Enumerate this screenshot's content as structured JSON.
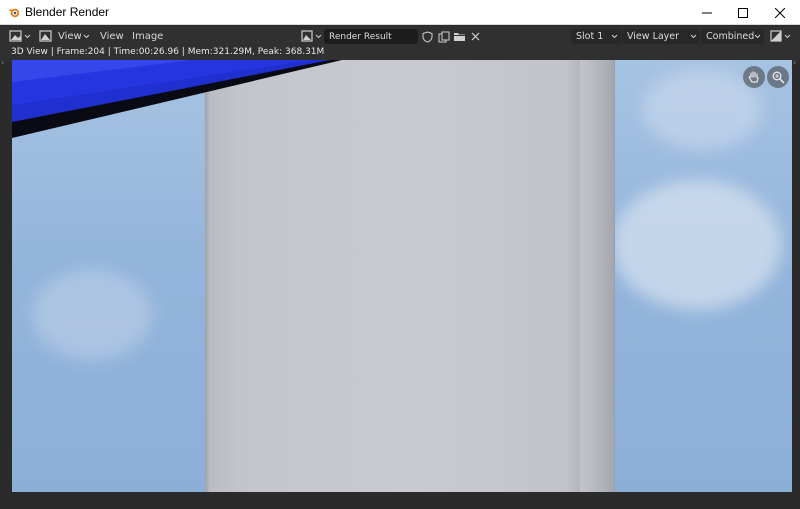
{
  "window": {
    "title": "Blender Render",
    "controls": [
      "minimize",
      "maximize",
      "close"
    ]
  },
  "header": {
    "editor_type_icon": "image-editor-icon",
    "view_mode_icon": "image-view-icon",
    "menus": [
      "View",
      "View",
      "Image"
    ],
    "image_browse_icon": "image-browse-icon",
    "image_name": "Render Result",
    "field_icons": [
      "fake-user-shield-icon",
      "duplicate-icon",
      "open-folder-icon",
      "close-icon"
    ],
    "slot": "Slot 1",
    "view_layer": "View Layer",
    "pass": "Combined",
    "display_channels_icon": "display-channels-icon"
  },
  "stats": {
    "text": "3D View | Frame:204 | Time:00:26.96 | Mem:321.29M, Peak: 368.31M"
  },
  "viewport": {
    "gizmos": [
      "pan-hand-icon",
      "zoom-magnifier-icon"
    ]
  },
  "colors": {
    "ui_bg": "#303030",
    "field_bg": "#1d1d1d",
    "sky": "#94b5dc",
    "tower": "#c9cad1",
    "roof_blue": "#1f2fd0"
  }
}
